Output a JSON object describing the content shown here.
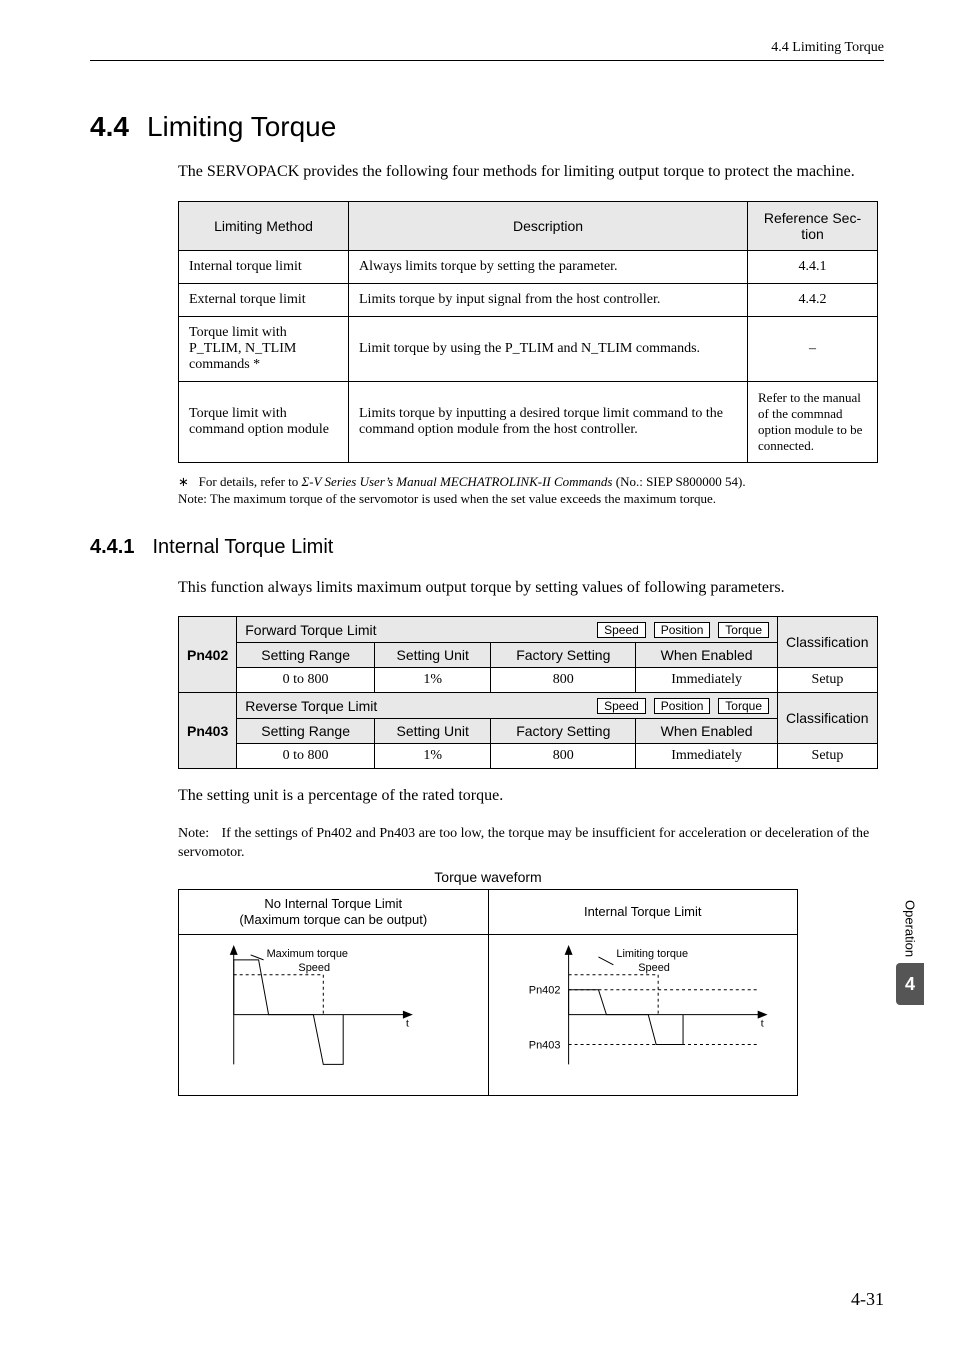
{
  "running_head": "4.4  Limiting Torque",
  "section": {
    "num": "4.4",
    "title": "Limiting Torque"
  },
  "intro": "The SERVOPACK provides the following four methods for limiting output torque to protect the machine.",
  "methods_table": {
    "headers": {
      "c1": "Limiting Method",
      "c2": "Description",
      "c3": "Reference Sec-\ntion"
    },
    "rows": [
      {
        "c1": "Internal torque limit",
        "c2": "Always limits torque by setting the parameter.",
        "c3": "4.4.1"
      },
      {
        "c1": "External torque limit",
        "c2": "Limits torque by input signal from the host controller.",
        "c3": "4.4.2"
      },
      {
        "c1": "Torque limit with P_TLIM, N_TLIM commands *",
        "c2": "Limit torque by using the P_TLIM and N_TLIM commands.",
        "c3": "–"
      },
      {
        "c1": "Torque limit with command option module",
        "c2": "Limits torque by inputting a desired torque limit command to the command option module from the host controller.",
        "c3": "Refer to the manual of the commnad option module to be connected."
      }
    ]
  },
  "footnote_ast": "∗",
  "footnote_text_before": "For details, refer to ",
  "footnote_italic": "Σ-V Series User’s Manual MECHATROLINK-II Commands",
  "footnote_text_after": " (No.: SIEP S800000 54).",
  "footnote_note_label": "Note:",
  "footnote_note": "The maximum torque of the servomotor is used when the set value exceeds the maximum torque.",
  "subsection": {
    "num": "4.4.1",
    "title": "Internal Torque Limit"
  },
  "sub_intro": "This function always limits maximum output torque by setting values of following parameters.",
  "param_table": {
    "classification_label": "Classification",
    "col_headers": {
      "range": "Setting Range",
      "unit": "Setting Unit",
      "factory": "Factory Setting",
      "enabled": "When Enabled"
    },
    "rows": [
      {
        "pn": "Pn402",
        "title": "Forward Torque Limit",
        "tags": [
          "Speed",
          "Position",
          "Torque"
        ],
        "range": "0 to 800",
        "unit": "1%",
        "factory": "800",
        "enabled": "Immediately",
        "class": "Setup"
      },
      {
        "pn": "Pn403",
        "title": "Reverse Torque Limit",
        "tags": [
          "Speed",
          "Position",
          "Torque"
        ],
        "range": "0 to 800",
        "unit": "1%",
        "factory": "800",
        "enabled": "Immediately",
        "class": "Setup"
      }
    ]
  },
  "after_param": "The setting unit is a percentage of the rated torque.",
  "param_note_label": "Note:",
  "param_note": "If the settings of Pn402 and Pn403 are too low, the torque may be insufficient for acceleration or deceleration of the servomotor.",
  "waveform": {
    "caption": "Torque waveform",
    "left_title_l1": "No Internal Torque Limit",
    "left_title_l2": "(Maximum torque can be output)",
    "right_title": "Internal Torque Limit",
    "left_labels": {
      "max": "Maximum torque",
      "speed": "Speed",
      "t": "t"
    },
    "right_labels": {
      "lim": "Limiting torque",
      "speed": "Speed",
      "pn402": "Pn402",
      "pn403": "Pn403",
      "t": "t"
    }
  },
  "side": {
    "label": "Operation",
    "num": "4"
  },
  "page_num": "4-31"
}
